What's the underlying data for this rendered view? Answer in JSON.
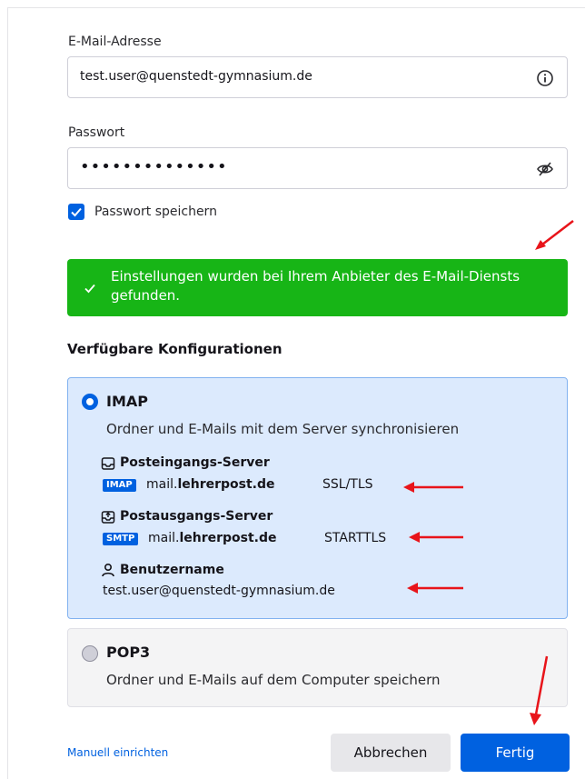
{
  "email": {
    "label": "E-Mail-Adresse",
    "value": "test.user@quenstedt-gymnasium.de",
    "trail_icon": "info-icon"
  },
  "password": {
    "label": "Passwort",
    "value": "••••••••••••••",
    "trail_icon": "eye-slash-icon"
  },
  "remember": {
    "label": "Passwort speichern",
    "checked": true
  },
  "banner": {
    "text": "Einstellungen wurden bei Ihrem Anbieter des E-Mail-Diensts gefunden.",
    "color": "#17b516"
  },
  "configs_title": "Verfügbare Konfigurationen",
  "imap": {
    "name": "IMAP",
    "selected": true,
    "description": "Ordner und E-Mails mit dem Server synchronisieren",
    "incoming": {
      "title": "Posteingangs-Server",
      "badge": "IMAP",
      "host_prefix": "mail.",
      "host_domain": "lehrerpost.de",
      "encryption": "SSL/TLS"
    },
    "outgoing": {
      "title": "Postausgangs-Server",
      "badge": "SMTP",
      "host_prefix": "mail.",
      "host_domain": "lehrerpost.de",
      "encryption": "STARTTLS"
    },
    "username": {
      "title": "Benutzername",
      "value": "test.user@quenstedt-gymnasium.de"
    }
  },
  "pop3": {
    "name": "POP3",
    "selected": false,
    "description": "Ordner und E-Mails auf dem Computer speichern"
  },
  "footer": {
    "manual_link": "Manuell einrichten",
    "cancel": "Abbrechen",
    "done": "Fertig"
  },
  "colors": {
    "accent": "#0061e0",
    "annotation_arrow": "#e8141a"
  }
}
